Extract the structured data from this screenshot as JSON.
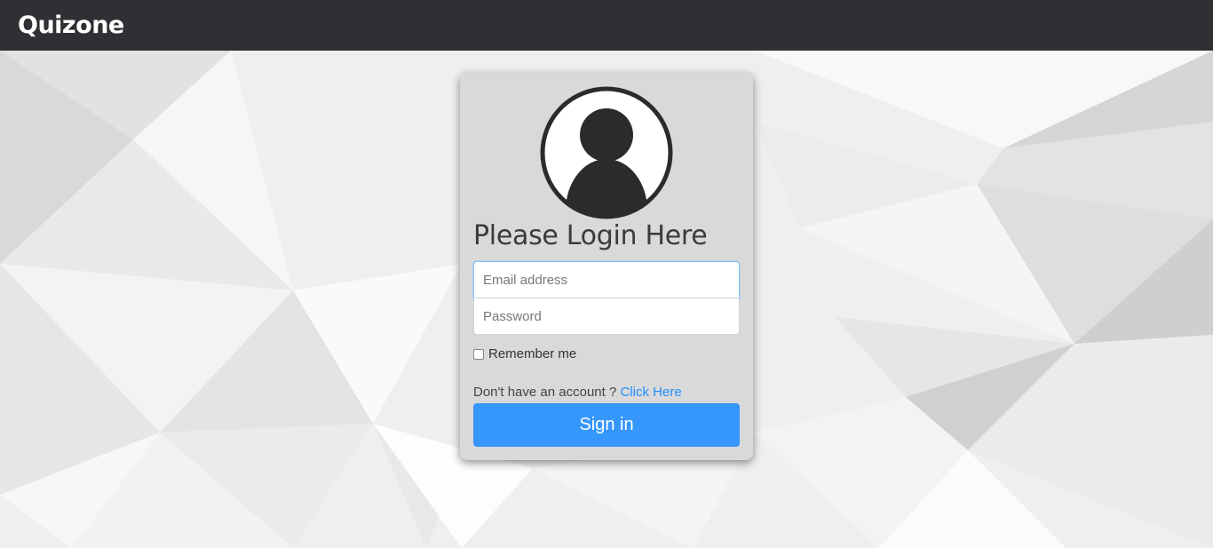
{
  "app": {
    "brand": "Quizone"
  },
  "login": {
    "heading": "Please Login Here",
    "email_placeholder": "Email address",
    "email_value": "",
    "password_placeholder": "Password",
    "remember_label": "Remember me",
    "remember_checked": false,
    "account_prompt": "Don't have an account ? ",
    "account_link": "Click Here",
    "submit_label": "Sign in"
  },
  "colors": {
    "navbar": "#2f3034",
    "card": "#d9d9d9",
    "primary": "#3596fb",
    "link": "#1f8fff"
  },
  "icons": {
    "avatar": "user-avatar-icon"
  }
}
